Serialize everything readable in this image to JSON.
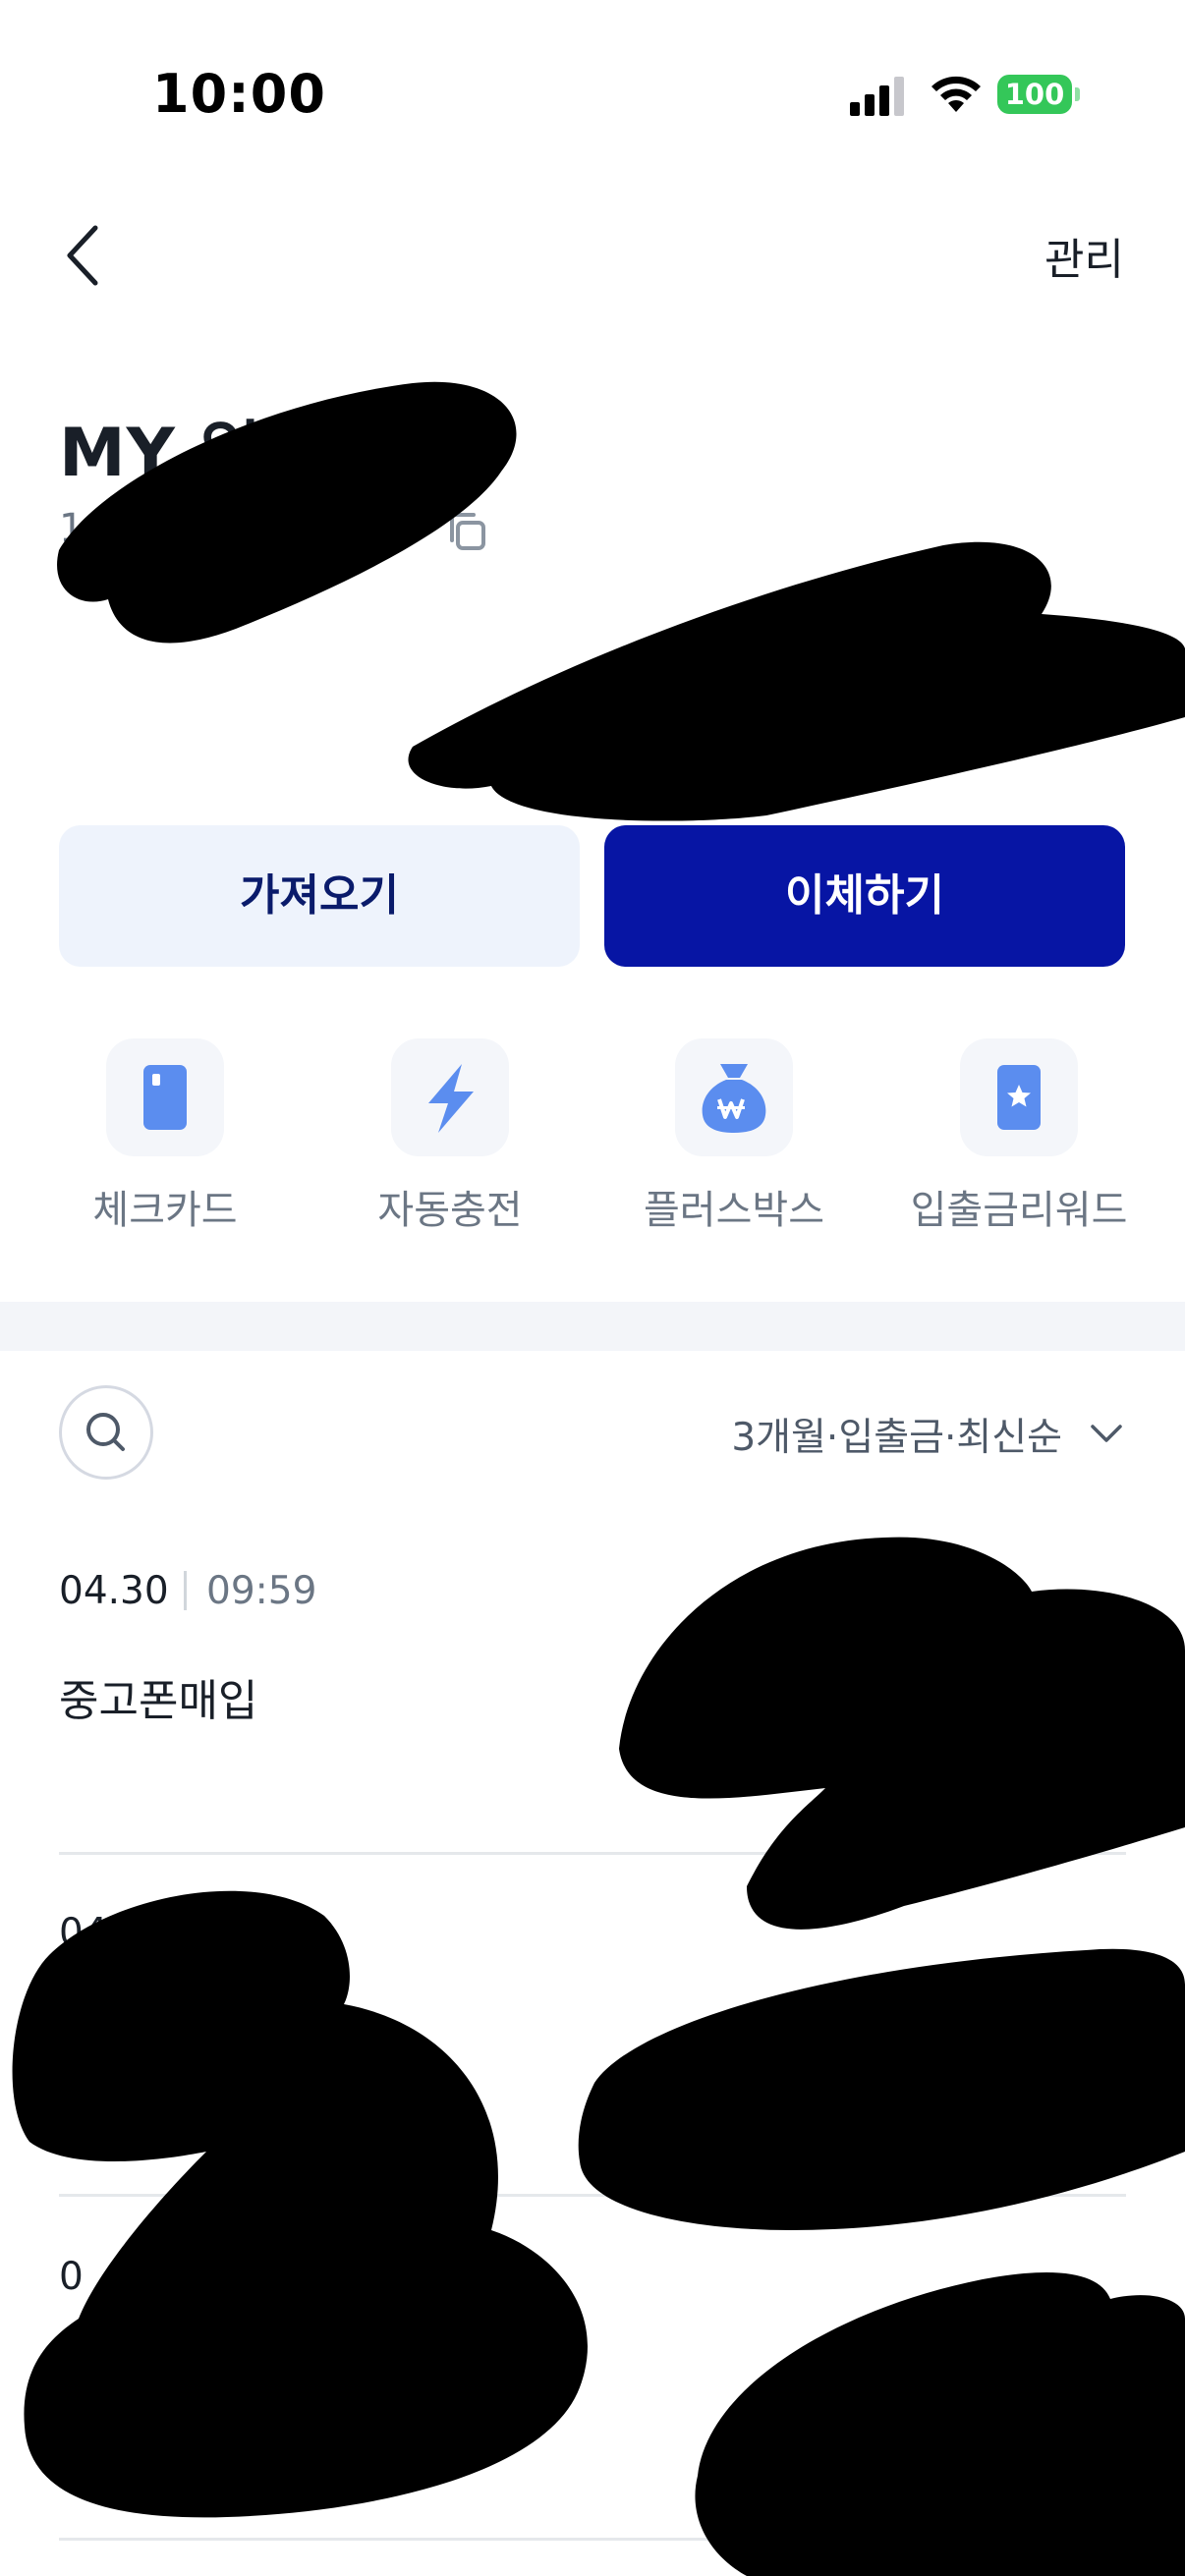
{
  "status_bar": {
    "time": "10:00",
    "battery": "100"
  },
  "header": {
    "manage_label": "관리"
  },
  "account": {
    "title": "MY 입",
    "number": "1"
  },
  "actions": {
    "import_label": "가져오기",
    "transfer_label": "이체하기"
  },
  "shortcuts": [
    {
      "label": "체크카드",
      "icon": "check-card-icon"
    },
    {
      "label": "자동충전",
      "icon": "lightning-icon"
    },
    {
      "label": "플러스박스",
      "icon": "money-bag-icon"
    },
    {
      "label": "입출금리워드",
      "icon": "star-card-icon"
    }
  ],
  "filter": {
    "label": "3개월·입출금·최신순"
  },
  "transactions": [
    {
      "date": "04.30",
      "time": "09:59",
      "title": "중고폰매입"
    },
    {
      "date": "04",
      "time": "",
      "title": ""
    },
    {
      "date": "0",
      "time": "",
      "title": ""
    }
  ],
  "colors": {
    "primary": "#0715a4",
    "secondary_bg": "#eef3fc",
    "icon_blue": "#5b8def",
    "battery": "#34c759"
  }
}
